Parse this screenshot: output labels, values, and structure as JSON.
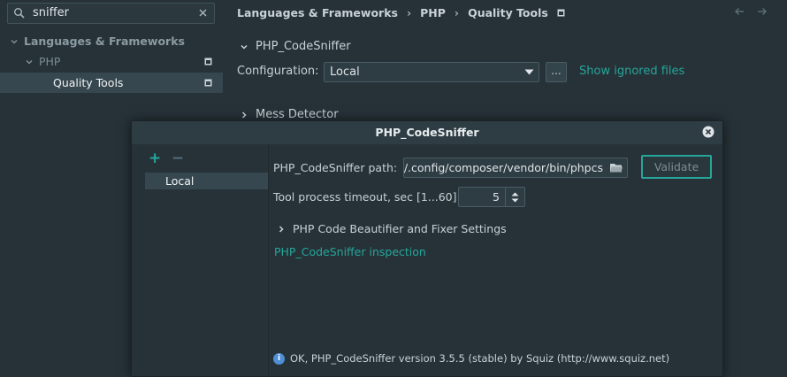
{
  "search": {
    "value": "sniffer"
  },
  "tree": {
    "items": [
      {
        "label": "Languages & Frameworks"
      },
      {
        "label": "PHP"
      },
      {
        "label": "Quality Tools"
      }
    ]
  },
  "breadcrumb": {
    "parts": [
      "Languages & Frameworks",
      "PHP",
      "Quality Tools"
    ],
    "separator": "›"
  },
  "main": {
    "codesniffer_section": "PHP_CodeSniffer",
    "configuration_label": "Configuration:",
    "configuration_value": "Local",
    "dots_label": "...",
    "show_ignored": "Show ignored files",
    "mess_detector_section": "Mess Detector"
  },
  "dialog": {
    "title": "PHP_CodeSniffer",
    "plus": "+",
    "minus": "−",
    "list_item": "Local",
    "path_label": "PHP_CodeSniffer path:",
    "path_value": "~/.config/composer/vendor/bin/phpcs",
    "validate_label": "Validate",
    "timeout_label": "Tool process timeout, sec [1...60]:",
    "timeout_value": "5",
    "beautifier_section": "PHP Code Beautifier and Fixer Settings",
    "inspection_link": "PHP_CodeSniffer inspection",
    "info_glyph": "i",
    "status": "OK, PHP_CodeSniffer version 3.5.5 (stable) by Squiz (http://www.squiz.net)"
  },
  "colors": {
    "background": "#263238",
    "accent": "#26a69a",
    "selection": "#37474f",
    "info": "#4f8fd6"
  }
}
